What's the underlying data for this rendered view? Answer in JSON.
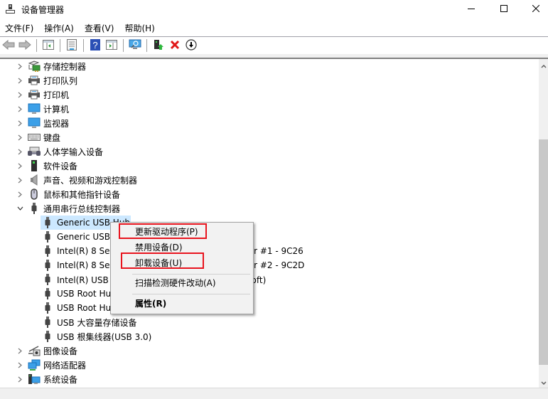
{
  "window": {
    "title": "设备管理器",
    "icon": "device-manager-icon",
    "controls": {
      "minimize": "minimize-icon",
      "maximize": "maximize-icon",
      "close": "close-icon"
    }
  },
  "menubar": {
    "items": [
      {
        "label": "文件(F)"
      },
      {
        "label": "操作(A)"
      },
      {
        "label": "查看(V)"
      },
      {
        "label": "帮助(H)"
      }
    ]
  },
  "toolbar": {
    "buttons": [
      {
        "name": "back",
        "icon": "arrow-left-icon"
      },
      {
        "name": "forward",
        "icon": "arrow-right-icon"
      },
      {
        "name": "show-hide-console-tree",
        "icon": "console-tree-icon"
      },
      {
        "name": "properties",
        "icon": "properties-sheet-icon"
      },
      {
        "name": "help",
        "icon": "help-icon"
      },
      {
        "name": "show-hide-action-pane",
        "icon": "action-pane-icon"
      },
      {
        "name": "scan-hardware",
        "icon": "scan-monitor-icon"
      },
      {
        "name": "update-driver",
        "icon": "update-driver-icon"
      },
      {
        "name": "uninstall-device",
        "icon": "red-x-icon"
      },
      {
        "name": "disable-device",
        "icon": "down-arrow-circle-icon"
      }
    ]
  },
  "tree": {
    "categories_top": [
      {
        "label": "存储控制器",
        "icon": "storage-controller-icon",
        "expanded": false
      },
      {
        "label": "打印队列",
        "icon": "printer-icon",
        "expanded": false
      },
      {
        "label": "打印机",
        "icon": "printer-icon",
        "expanded": false
      },
      {
        "label": "计算机",
        "icon": "computer-icon",
        "expanded": false
      },
      {
        "label": "监视器",
        "icon": "monitor-icon",
        "expanded": false
      },
      {
        "label": "键盘",
        "icon": "keyboard-icon",
        "expanded": false
      },
      {
        "label": "人体学输入设备",
        "icon": "hid-icon",
        "expanded": false
      },
      {
        "label": "软件设备",
        "icon": "software-device-icon",
        "expanded": false
      },
      {
        "label": "声音、视频和游戏控制器",
        "icon": "speaker-icon",
        "expanded": false
      },
      {
        "label": "鼠标和其他指针设备",
        "icon": "mouse-icon",
        "expanded": false
      },
      {
        "label": "通用串行总线控制器",
        "icon": "usb-icon",
        "expanded": true
      }
    ],
    "usb_children": [
      {
        "label": "Generic USB Hub",
        "selected": true
      },
      {
        "label": "Generic USB Hub"
      },
      {
        "label": "Intel(R) 8 Series USB Enhanced Host Controller #1 - 9C26"
      },
      {
        "label": "Intel(R) 8 Series USB Enhanced Host Controller #2 - 9C2D"
      },
      {
        "label": "Intel(R) USB 3.0 可扩展主机控制器 - 1.0 (Microsoft)"
      },
      {
        "label": "USB Root Hub"
      },
      {
        "label": "USB Root Hub"
      },
      {
        "label": "USB 大容量存储设备"
      },
      {
        "label": "USB 根集线器(USB 3.0)"
      }
    ],
    "visible_tails": [
      "6",
      "D",
      "ft)"
    ],
    "categories_bottom": [
      {
        "label": "图像设备",
        "icon": "camera-icon",
        "expanded": false
      },
      {
        "label": "网络适配器",
        "icon": "network-adapter-icon",
        "expanded": false
      },
      {
        "label": "系统设备",
        "icon": "system-device-icon",
        "expanded": false
      }
    ]
  },
  "context_menu": {
    "items": [
      {
        "label": "更新驱动程序(P)",
        "highlighted": true
      },
      {
        "label": "禁用设备(D)"
      },
      {
        "label": "卸载设备(U)",
        "highlighted": true
      },
      {
        "separator": true
      },
      {
        "label": "扫描检测硬件改动(A)"
      },
      {
        "separator": true
      },
      {
        "label": "属性(R)",
        "bold": true
      }
    ],
    "highlight_color": "#e8141e"
  },
  "scrollbar": {
    "position_fraction": 0.26,
    "visible_fraction": 0.69
  },
  "colors": {
    "selection": "#cce8ff",
    "menu_bg": "#f2f2f2"
  }
}
